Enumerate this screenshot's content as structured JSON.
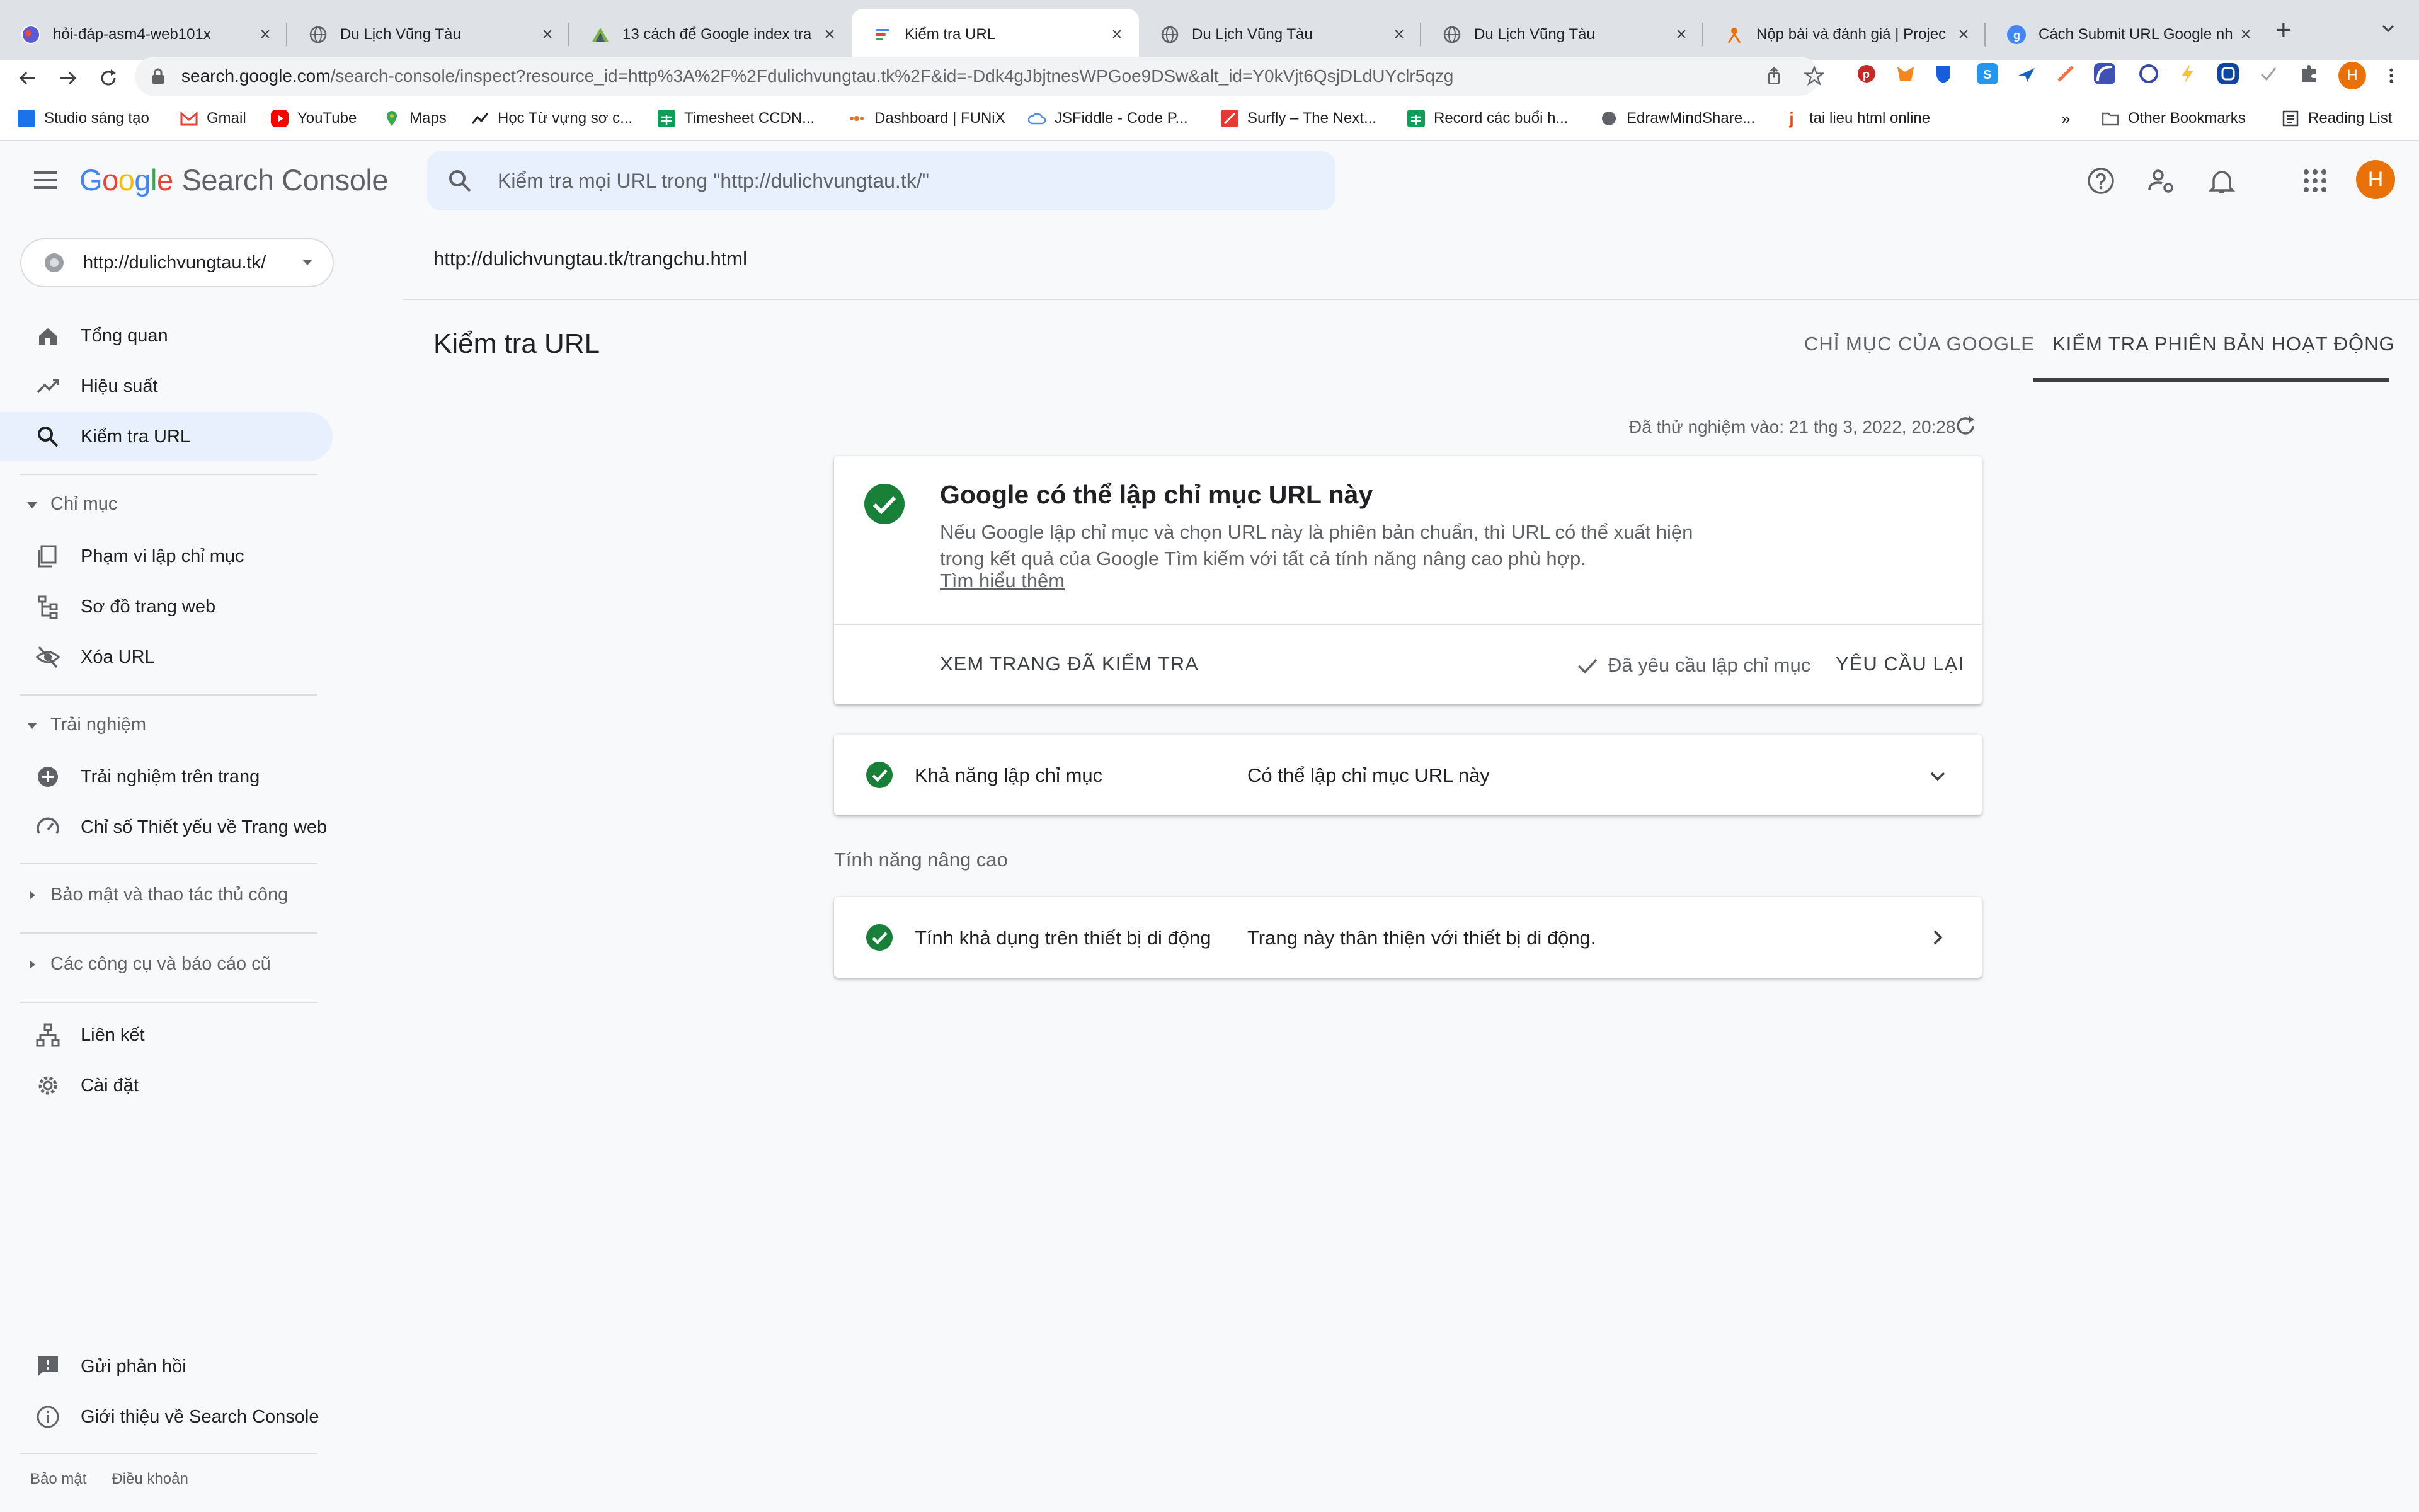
{
  "browser": {
    "tabs": [
      {
        "title": "hỏi-đáp-asm4-web101x"
      },
      {
        "title": "Du Lịch Vũng Tàu"
      },
      {
        "title": "13 cách để Google index tra"
      },
      {
        "title": "Kiểm tra URL"
      },
      {
        "title": "Du Lịch Vũng Tàu"
      },
      {
        "title": "Du Lịch Vũng Tàu"
      },
      {
        "title": "Nộp bài và đánh giá | Projec"
      },
      {
        "title": "Cách Submit URL Google nh"
      }
    ],
    "url_domain": "search.google.com",
    "url_path": "/search-console/inspect?resource_id=http%3A%2F%2Fdulichvungtau.tk%2F&id=-Ddk4gJbjtnesWPGoe9DSw&alt_id=Y0kVjt6QsjDLdUYclr5qzg",
    "profile_initial": "H",
    "bookmarks": [
      {
        "label": "Studio sáng tạo"
      },
      {
        "label": "Gmail"
      },
      {
        "label": "YouTube"
      },
      {
        "label": "Maps"
      },
      {
        "label": "Học Từ vựng sơ c..."
      },
      {
        "label": "Timesheet CCDN..."
      },
      {
        "label": "Dashboard | FUNiX"
      },
      {
        "label": "JSFiddle - Code P..."
      },
      {
        "label": "Surfly – The Next..."
      },
      {
        "label": "Record các buổi h..."
      },
      {
        "label": "EdrawMindShare..."
      },
      {
        "label": "tai lieu html online"
      }
    ],
    "bookmarks_more": "»",
    "other_bookmarks": "Other Bookmarks",
    "reading_list": "Reading List"
  },
  "app": {
    "logo_google": [
      "G",
      "o",
      "o",
      "g",
      "l",
      "e"
    ],
    "logo_suffix": "Search Console",
    "search_placeholder": "Kiểm tra mọi URL trong \"http://dulichvungtau.tk/\"",
    "avatar_initial": "H"
  },
  "sidebar": {
    "property": "http://dulichvungtau.tk/",
    "overview": "Tổng quan",
    "performance": "Hiệu suất",
    "url_inspection": "Kiểm tra URL",
    "index_section": "Chỉ mục",
    "coverage": "Phạm vi lập chỉ mục",
    "sitemaps": "Sơ đồ trang web",
    "removals": "Xóa URL",
    "experience_section": "Trải nghiệm",
    "page_experience": "Trải nghiệm trên trang",
    "core_web_vitals": "Chỉ số Thiết yếu về Trang web",
    "security_section": "Bảo mật và thao tác thủ công",
    "legacy_section": "Các công cụ và báo cáo cũ",
    "links": "Liên kết",
    "settings": "Cài đặt",
    "feedback": "Gửi phản hồi",
    "about": "Giới thiệu về Search Console",
    "privacy": "Bảo mật",
    "terms": "Điều khoản"
  },
  "main": {
    "inspected_url": "http://dulichvungtau.tk/trangchu.html",
    "title": "Kiểm tra URL",
    "tab_google_index": "CHỈ MỤC CỦA GOOGLE",
    "tab_live_test": "KIỂM TRA PHIÊN BẢN HOẠT ĐỘNG",
    "tested_at": "Đã thử nghiệm vào: 21 thg 3, 2022, 20:28",
    "result_title": "Google có thể lập chỉ mục URL này",
    "result_desc": "Nếu Google lập chỉ mục và chọn URL này là phiên bản chuẩn, thì URL có thể xuất hiện trong kết quả của Google Tìm kiếm với tất cả tính năng nâng cao phù hợp.",
    "learn_more": "Tìm hiểu thêm",
    "view_tested_page": "XEM TRANG ĐÃ KIỂM TRA",
    "indexing_requested": "Đã yêu cầu lập chỉ mục",
    "request_again": "YÊU CẦU LẠI",
    "indexability_label": "Khả năng lập chỉ mục",
    "indexability_value": "Có thể lập chỉ mục URL này",
    "enhancements_label": "Tính năng nâng cao",
    "mobile_label": "Tính khả dụng trên thiết bị di động",
    "mobile_value": "Trang này thân thiện với thiết bị di động."
  },
  "colors": {
    "accent_blue": "#1a73e8",
    "success_green": "#188038",
    "active_nav_bg": "#e8f0fe",
    "avatar_orange": "#e8710a"
  }
}
